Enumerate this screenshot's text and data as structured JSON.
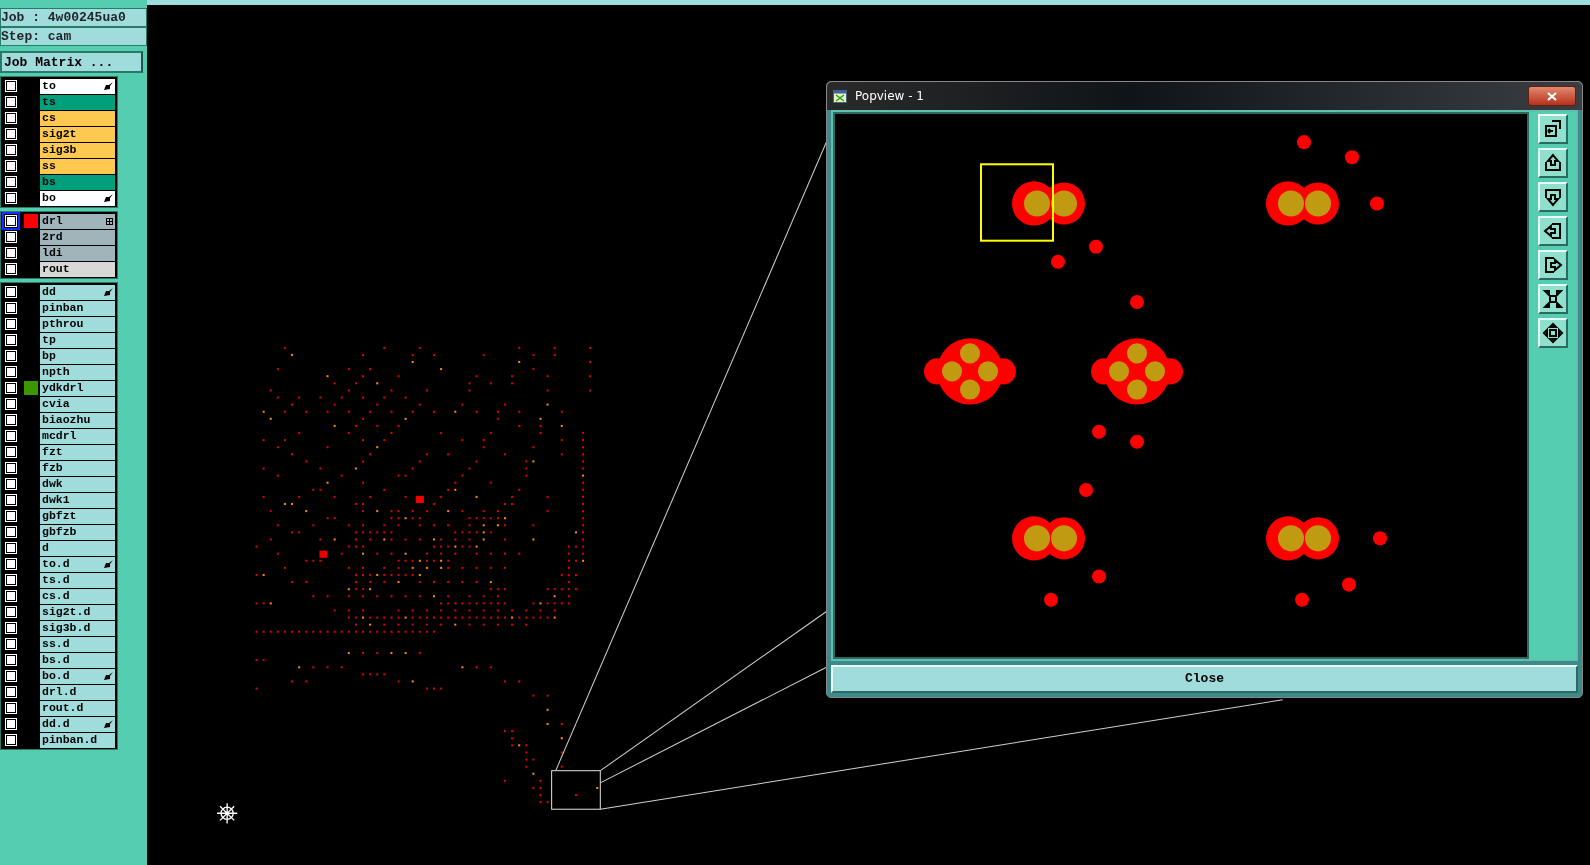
{
  "job_label": "Job : 4w00245ua0",
  "step_label": "Step: cam",
  "matrix_button": "Job Matrix ...",
  "layer_groups": [
    [
      {
        "name": "to",
        "color": "#ffffff",
        "checked": false,
        "selected": false,
        "pointer": true
      },
      {
        "name": "ts",
        "color": "#00a07c",
        "checked": false,
        "selected": false
      },
      {
        "name": "cs",
        "color": "#ffc850",
        "checked": false,
        "selected": false
      },
      {
        "name": "sig2t",
        "color": "#ffc850",
        "checked": false,
        "selected": false
      },
      {
        "name": "sig3b",
        "color": "#ffc850",
        "checked": false,
        "selected": false
      },
      {
        "name": "ss",
        "color": "#ffc850",
        "checked": false,
        "selected": false
      },
      {
        "name": "bs",
        "color": "#00a07c",
        "checked": false,
        "selected": false
      },
      {
        "name": "bo",
        "color": "#ffffff",
        "checked": false,
        "selected": false,
        "pointer": true
      }
    ],
    [
      {
        "name": "drl",
        "color": "#a0b4bc",
        "checked": false,
        "selected": true,
        "swatch": {
          "color": "#ff0000"
        },
        "plus_box": true
      },
      {
        "name": "2rd",
        "color": "#a0b4bc",
        "checked": false,
        "selected": false
      },
      {
        "name": "ldi",
        "color": "#a0b4bc",
        "checked": false,
        "selected": false
      },
      {
        "name": "rout",
        "color": "#d8d8d8",
        "checked": false,
        "selected": false
      }
    ],
    [
      {
        "name": "dd",
        "color": "#a0dcdc",
        "checked": false,
        "selected": false,
        "pointer": true
      },
      {
        "name": "pinban",
        "color": "#a0dcdc",
        "checked": false,
        "selected": false
      },
      {
        "name": "pthrou",
        "color": "#a0dcdc",
        "checked": false,
        "selected": false
      },
      {
        "name": "tp",
        "color": "#a0dcdc",
        "checked": false,
        "selected": false
      },
      {
        "name": "bp",
        "color": "#a0dcdc",
        "checked": false,
        "selected": false
      },
      {
        "name": "npth",
        "color": "#a0dcdc",
        "checked": false,
        "selected": false
      },
      {
        "name": "ydkdrl",
        "color": "#a0dcdc",
        "checked": false,
        "selected": false,
        "swatch": {
          "color": "#3c9600"
        }
      },
      {
        "name": "cvia",
        "color": "#a0dcdc",
        "checked": false,
        "selected": false
      },
      {
        "name": "biaozhu",
        "color": "#a0dcdc",
        "checked": false,
        "selected": false
      },
      {
        "name": "mcdrl",
        "color": "#a0dcdc",
        "checked": false,
        "selected": false
      },
      {
        "name": "fzt",
        "color": "#a0dcdc",
        "checked": false,
        "selected": false
      },
      {
        "name": "fzb",
        "color": "#a0dcdc",
        "checked": false,
        "selected": false
      },
      {
        "name": "dwk",
        "color": "#a0dcdc",
        "checked": false,
        "selected": false
      },
      {
        "name": "dwk1",
        "color": "#a0dcdc",
        "checked": false,
        "selected": false
      },
      {
        "name": "gbfzt",
        "color": "#a0dcdc",
        "checked": false,
        "selected": false
      },
      {
        "name": "gbfzb",
        "color": "#a0dcdc",
        "checked": false,
        "selected": false
      },
      {
        "name": "d",
        "color": "#a0dcdc",
        "checked": false,
        "selected": false
      },
      {
        "name": "to.d",
        "color": "#a0dcdc",
        "checked": false,
        "selected": false,
        "pointer": true
      },
      {
        "name": "ts.d",
        "color": "#a0dcdc",
        "checked": false,
        "selected": false
      },
      {
        "name": "cs.d",
        "color": "#a0dcdc",
        "checked": false,
        "selected": false
      },
      {
        "name": "sig2t.d",
        "color": "#a0dcdc",
        "checked": false,
        "selected": false
      },
      {
        "name": "sig3b.d",
        "color": "#a0dcdc",
        "checked": false,
        "selected": false
      },
      {
        "name": "ss.d",
        "color": "#a0dcdc",
        "checked": false,
        "selected": false
      },
      {
        "name": "bs.d",
        "color": "#a0dcdc",
        "checked": false,
        "selected": false
      },
      {
        "name": "bo.d",
        "color": "#a0dcdc",
        "checked": false,
        "selected": false,
        "pointer": true
      },
      {
        "name": "drl.d",
        "color": "#a0dcdc",
        "checked": false,
        "selected": false
      },
      {
        "name": "rout.d",
        "color": "#a0dcdc",
        "checked": false,
        "selected": false
      },
      {
        "name": "dd.d",
        "color": "#a0dcdc",
        "checked": false,
        "selected": false,
        "pointer": true
      },
      {
        "name": "pinban.d",
        "color": "#a0dcdc",
        "checked": false,
        "selected": false
      }
    ]
  ],
  "popview": {
    "title": "Popview - 1",
    "close_button": "Close"
  }
}
